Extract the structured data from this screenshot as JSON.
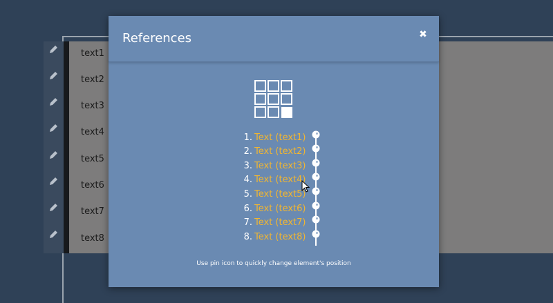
{
  "background": {
    "items": [
      "text1",
      "text2",
      "text3",
      "text4",
      "text5",
      "text6",
      "text7",
      "text8"
    ],
    "edit_icon": "pencil-icon"
  },
  "modal": {
    "title": "References",
    "close_icon": "close-icon",
    "layout_icon": "grid-icon",
    "references": [
      {
        "number": "1.",
        "label": "Text (text1)"
      },
      {
        "number": "2.",
        "label": "Text (text2)"
      },
      {
        "number": "3.",
        "label": "Text (text3)"
      },
      {
        "number": "4.",
        "label": "Text (text4)"
      },
      {
        "number": "5.",
        "label": "Text (text5)"
      },
      {
        "number": "6.",
        "label": "Text (text6)"
      },
      {
        "number": "7.",
        "label": "Text (text7)"
      },
      {
        "number": "8.",
        "label": "Text (text8)"
      }
    ],
    "pin_icon": "pin-icon",
    "hint": "Use pin icon to quickly change element's position"
  },
  "colors": {
    "page_bg": "#2f4157",
    "modal_bg": "#6a8ab2",
    "link": "#f2b630",
    "list_bg": "#7d7c7c"
  }
}
